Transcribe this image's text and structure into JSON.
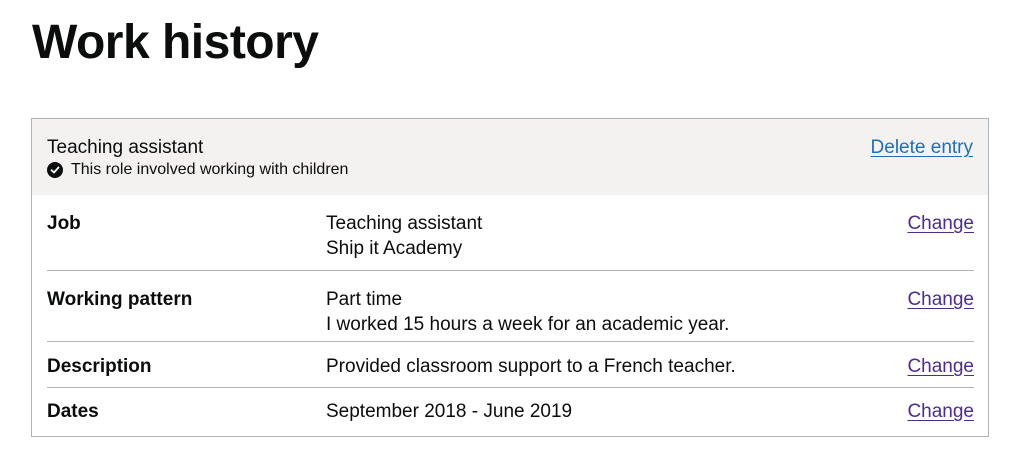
{
  "page": {
    "title": "Work history"
  },
  "entry": {
    "title": "Teaching assistant",
    "tag": "This role involved working with children",
    "delete_label": "Delete entry",
    "rows": [
      {
        "key": "Job",
        "lines": [
          "Teaching assistant",
          "Ship it Academy"
        ],
        "action": "Change"
      },
      {
        "key": "Working pattern",
        "lines": [
          "Part time",
          "I worked 15 hours a week for an academic year."
        ],
        "action": "Change"
      },
      {
        "key": "Description",
        "lines": [
          "Provided classroom support to a French teacher."
        ],
        "action": "Change"
      },
      {
        "key": "Dates",
        "lines": [
          "September 2018 - June 2019"
        ],
        "action": "Change"
      }
    ]
  },
  "colors": {
    "text": "#0b0c0c",
    "link": "#1d70b8",
    "visited_link": "#4c2c92",
    "header_bg": "#f3f2f1",
    "border": "#b1b4b6"
  },
  "icons": {
    "tag_icon": "check-circle-icon"
  }
}
